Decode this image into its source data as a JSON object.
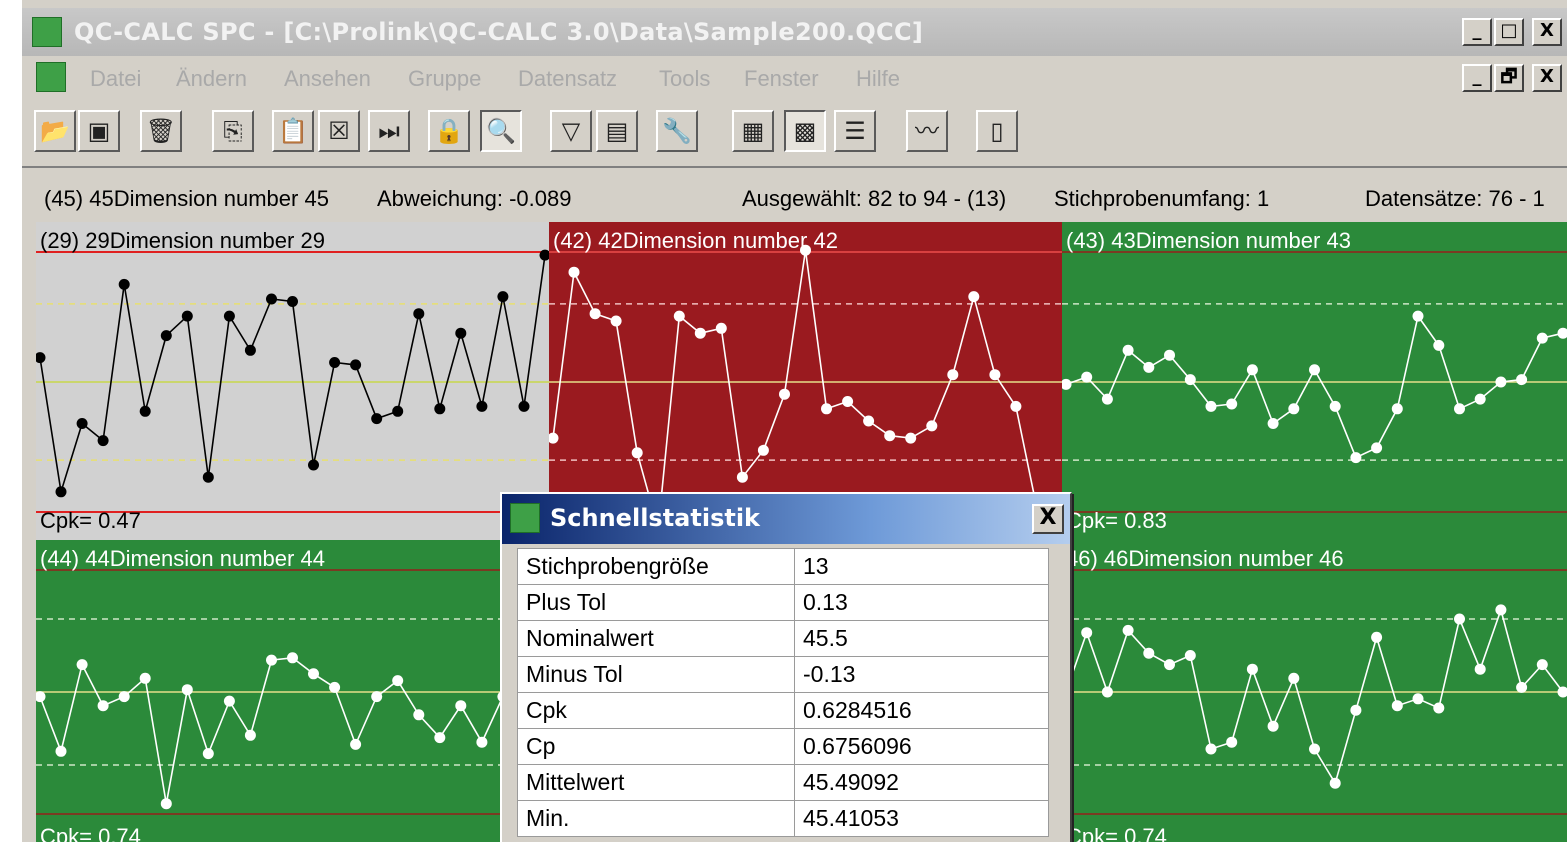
{
  "window": {
    "title": "QC-CALC SPC - [C:\\Prolink\\QC-CALC 3.0\\Data\\Sample200.QCC]",
    "caption_buttons": [
      "_",
      "□",
      "X"
    ],
    "mdi_buttons": [
      "_",
      "🗗",
      "X"
    ]
  },
  "menu": [
    "Datei",
    "Ändern",
    "Ansehen",
    "Gruppe",
    "Datensatz",
    "Tools",
    "Fenster",
    "Hilfe"
  ],
  "toolbar": [
    {
      "icon": "open-folder-icon",
      "glyph": "📂"
    },
    {
      "icon": "save-icon",
      "glyph": "▣"
    },
    {
      "icon": "trash-icon",
      "glyph": "🗑"
    },
    {
      "icon": "copy-icon",
      "glyph": "⎘"
    },
    {
      "icon": "paste-icon",
      "glyph": "📋"
    },
    {
      "icon": "close-box-icon",
      "glyph": "☒"
    },
    {
      "icon": "skip-to-end-icon",
      "glyph": "⏭"
    },
    {
      "icon": "lock-icon",
      "glyph": "🔒"
    },
    {
      "icon": "print-preview-icon",
      "glyph": "🔍"
    },
    {
      "icon": "filter-icon",
      "glyph": "▽"
    },
    {
      "icon": "data-select-icon",
      "glyph": "▤"
    },
    {
      "icon": "wrench-icon",
      "glyph": "🔧"
    },
    {
      "icon": "table-view-icon",
      "glyph": "▦"
    },
    {
      "icon": "chart-grid-icon",
      "glyph": "▩"
    },
    {
      "icon": "report-icon",
      "glyph": "☰"
    },
    {
      "icon": "control-chart-icon",
      "glyph": "〰"
    },
    {
      "icon": "exit-door-icon",
      "glyph": "▯"
    }
  ],
  "info": {
    "dimension": "(45) 45Dimension number 45",
    "deviation": "Abweichung: -0.089",
    "selected": "Ausgewählt: 82 to 94 - (13)",
    "sample_size": "Stichprobenumfang: 1",
    "records": "Datensätze: 76 - 1"
  },
  "colors": {
    "panel_grey": "#d1d1d1",
    "panel_red": "#9a1a1f",
    "panel_green": "#2b8a3a",
    "limit_red": "#e02020",
    "limit_dark": "#7a3a22",
    "mean_yellow": "#e6e08a"
  },
  "panels": [
    {
      "title": "(29) 29Dimension number 29",
      "cpk": "Cpk= 0.47",
      "theme": "grey",
      "chart_data": {
        "type": "line",
        "ylim": [
          0,
          1
        ],
        "values": [
          0.6,
          0.05,
          0.33,
          0.26,
          0.9,
          0.38,
          0.69,
          0.77,
          0.11,
          0.77,
          0.63,
          0.84,
          0.83,
          0.16,
          0.58,
          0.57,
          0.35,
          0.38,
          0.78,
          0.39,
          0.7,
          0.4,
          0.85,
          0.4,
          1.02
        ]
      }
    },
    {
      "title": "(42) 42Dimension number 42",
      "cpk": "",
      "theme": "red",
      "chart_data": {
        "type": "line",
        "ylim": [
          0,
          1
        ],
        "values": [
          0.27,
          0.95,
          0.78,
          0.75,
          0.21,
          -0.1,
          0.77,
          0.7,
          0.72,
          0.11,
          0.22,
          0.45,
          1.04,
          0.39,
          0.42,
          0.34,
          0.28,
          0.27,
          0.32,
          0.53,
          0.85,
          0.53,
          0.4,
          -0.02,
          -0.1
        ]
      }
    },
    {
      "title": "(43) 43Dimension number 43",
      "cpk": "Cpk= 0.83",
      "theme": "green",
      "chart_data": {
        "type": "line",
        "ylim": [
          0,
          1
        ],
        "values": [
          0.49,
          0.52,
          0.43,
          0.63,
          0.56,
          0.61,
          0.51,
          0.4,
          0.41,
          0.55,
          0.33,
          0.39,
          0.55,
          0.4,
          0.19,
          0.23,
          0.39,
          0.77,
          0.65,
          0.39,
          0.43,
          0.5,
          0.51,
          0.68,
          0.7
        ]
      }
    },
    {
      "title": "(44) 44Dimension number 44",
      "cpk": "Cpk= 0.74",
      "theme": "green",
      "chart_data": {
        "type": "line",
        "ylim": [
          0,
          1
        ],
        "values": [
          0.48,
          0.24,
          0.62,
          0.44,
          0.48,
          0.56,
          0.01,
          0.51,
          0.23,
          0.46,
          0.31,
          0.64,
          0.65,
          0.58,
          0.52,
          0.27,
          0.48,
          0.55,
          0.4,
          0.3,
          0.44,
          0.28,
          0.48,
          0.58,
          0.46
        ]
      }
    },
    {
      "title": "46) 46Dimension number 46",
      "cpk": "Cpk= 0.74",
      "theme": "green",
      "chart_data": {
        "type": "line",
        "ylim": [
          0,
          1
        ],
        "values": [
          0.5,
          0.76,
          0.5,
          0.77,
          0.67,
          0.62,
          0.66,
          0.25,
          0.28,
          0.6,
          0.35,
          0.56,
          0.25,
          0.1,
          0.42,
          0.74,
          0.44,
          0.47,
          0.43,
          0.82,
          0.6,
          0.86,
          0.52,
          0.62,
          0.5
        ]
      }
    }
  ],
  "dialog": {
    "title": "Schnellstatistik",
    "close": "X",
    "rows": [
      {
        "label": "Stichprobengröße",
        "value": "13"
      },
      {
        "label": "Plus Tol",
        "value": "0.13"
      },
      {
        "label": "Nominalwert",
        "value": "45.5"
      },
      {
        "label": "Minus Tol",
        "value": "-0.13"
      },
      {
        "label": "Cpk",
        "value": "0.6284516"
      },
      {
        "label": "Cp",
        "value": "0.6756096"
      },
      {
        "label": "Mittelwert",
        "value": "45.49092"
      },
      {
        "label": "Min.",
        "value": "45.41053"
      }
    ]
  }
}
